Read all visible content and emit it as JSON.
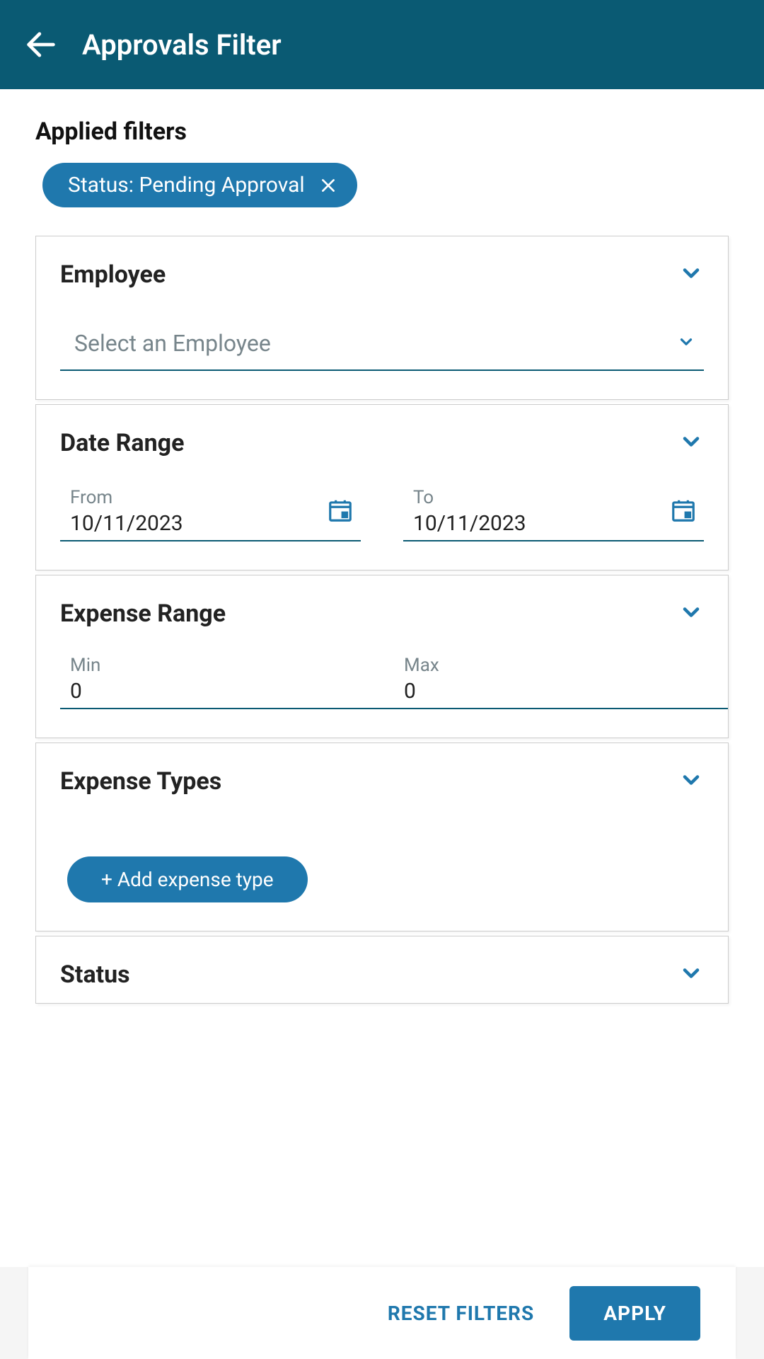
{
  "header": {
    "title": "Approvals Filter"
  },
  "applied": {
    "label": "Applied filters",
    "chip_text": "Status: Pending Approval"
  },
  "sections": {
    "employee": {
      "title": "Employee",
      "placeholder": "Select an Employee"
    },
    "dateRange": {
      "title": "Date Range",
      "from_label": "From",
      "from_value": "10/11/2023",
      "to_label": "To",
      "to_value": "10/11/2023"
    },
    "expenseRange": {
      "title": "Expense Range",
      "min_label": "Min",
      "min_value": "0",
      "max_label": "Max",
      "max_value": "0"
    },
    "expenseTypes": {
      "title": "Expense Types",
      "add_label": "+ Add expense type"
    },
    "status": {
      "title": "Status"
    }
  },
  "footer": {
    "reset": "RESET FILTERS",
    "apply": "APPLY"
  }
}
